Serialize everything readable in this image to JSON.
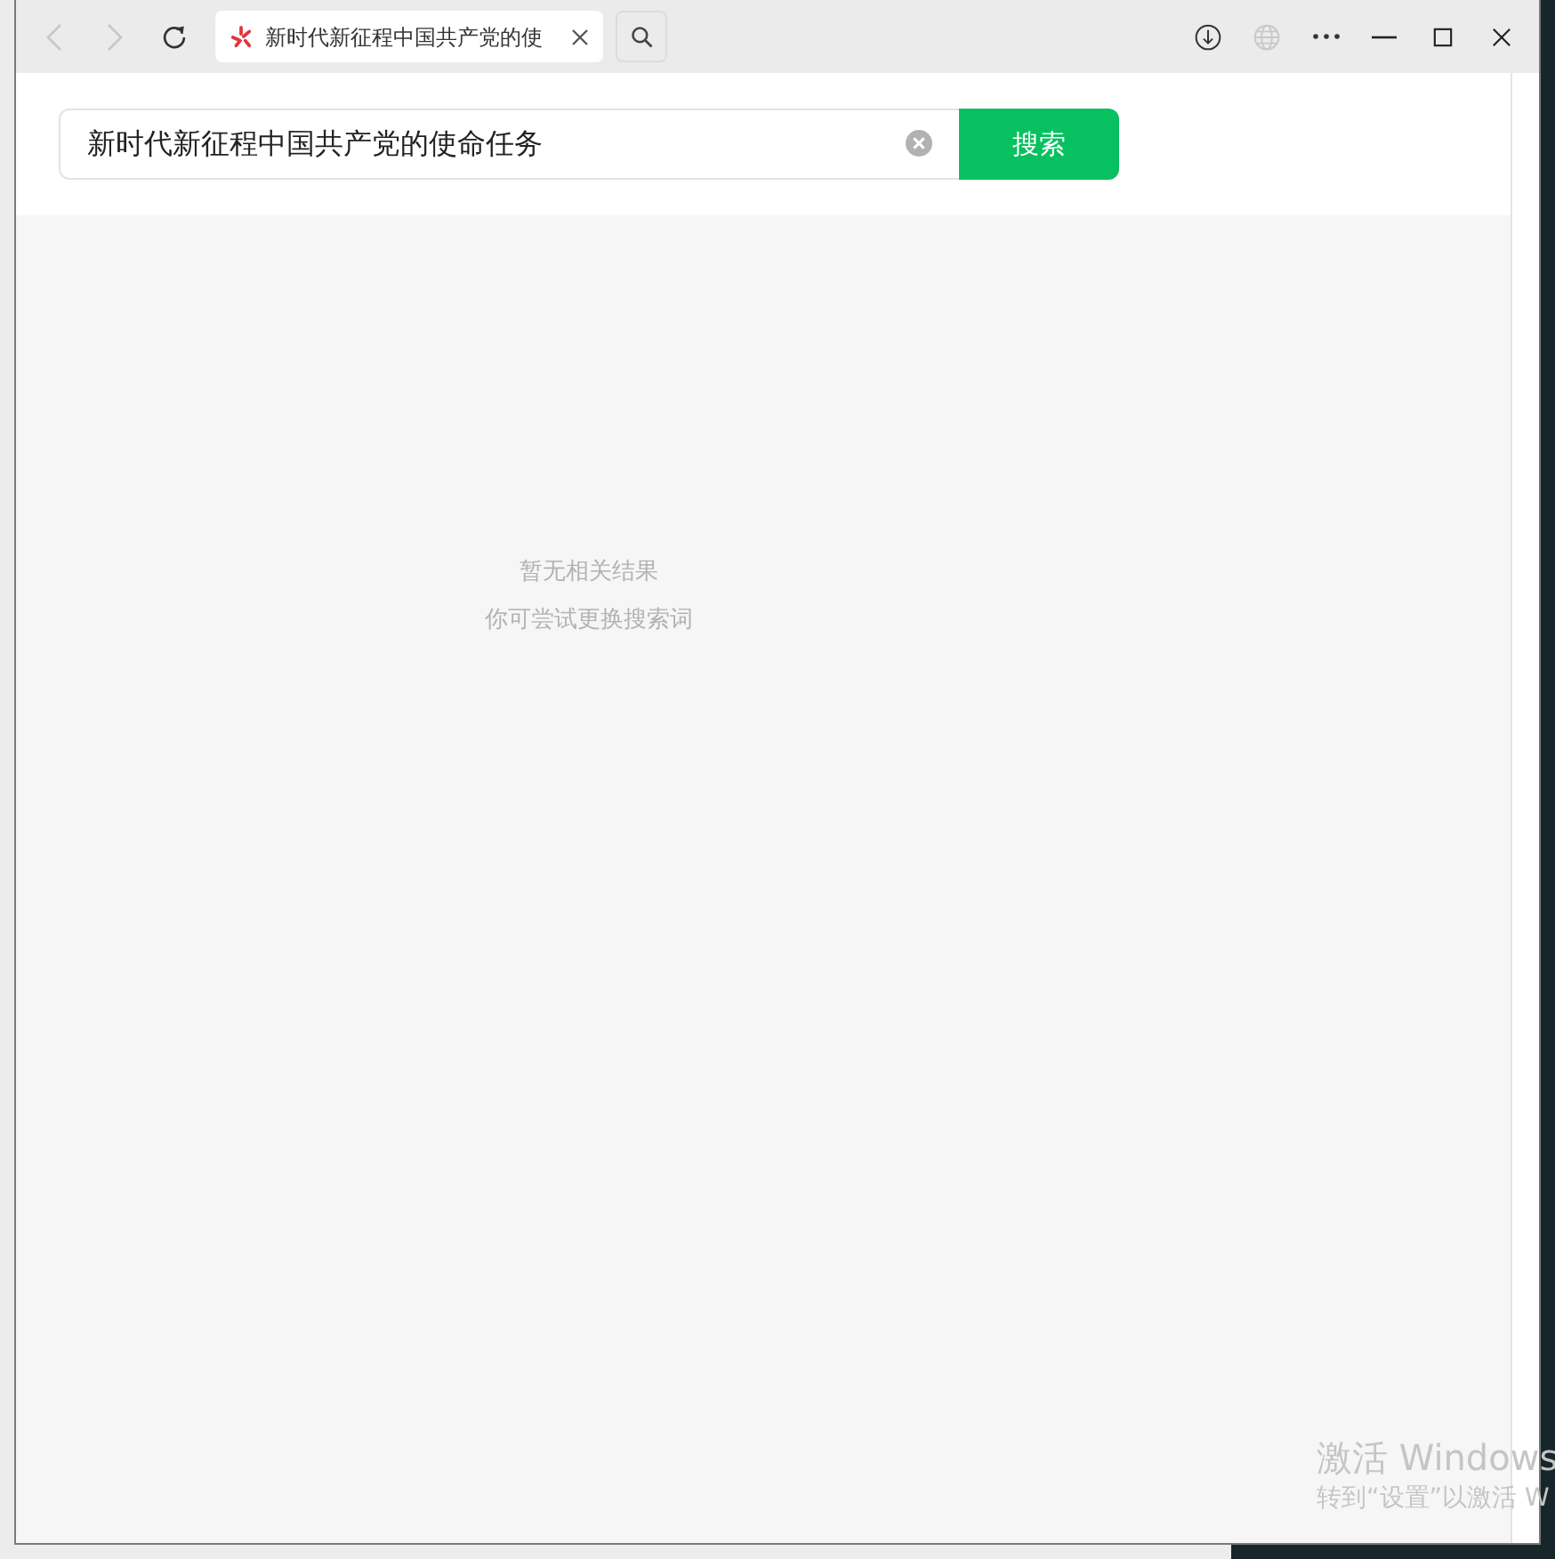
{
  "browser": {
    "nav": [
      {
        "kind": "back",
        "disabled": true
      },
      {
        "kind": "forward",
        "disabled": true
      },
      {
        "kind": "reload",
        "disabled": false
      }
    ],
    "tab": {
      "title": "新时代新征程中国共产党的使"
    },
    "toolbar": [
      {
        "kind": "download",
        "disabled": false
      },
      {
        "kind": "globe",
        "disabled": true
      },
      {
        "kind": "more",
        "disabled": false
      }
    ]
  },
  "search": {
    "value": "新时代新征程中国共产党的使命任务",
    "button": "搜索"
  },
  "empty_state": {
    "title": "暂无相关结果",
    "hint": "你可尝试更换搜索词"
  },
  "activation_notice": {
    "title": "激活 Windows",
    "hint": "转到“设置”以激活 W"
  }
}
